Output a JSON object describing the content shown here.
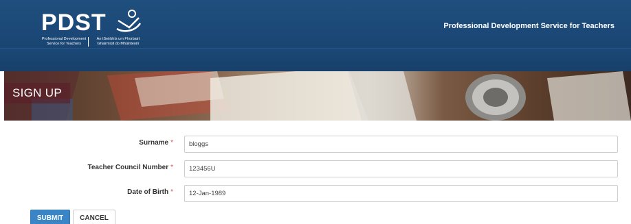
{
  "header": {
    "logo": {
      "wordmark": "PDST",
      "sub_left": "Professional Development Service for Teachers",
      "sub_right": "An tSeirbhís um Fhorbairt Ghairmiúil do Mhúinteoirí"
    },
    "tagline": "Professional Development Service for Teachers"
  },
  "banner": {
    "title": "SIGN UP"
  },
  "form": {
    "required_marker": "*",
    "fields": [
      {
        "label": "Surname",
        "value": "bloggs"
      },
      {
        "label": "Teacher Council Number",
        "value": "123456U"
      },
      {
        "label": "Date of Birth",
        "value": "12-Jan-1989"
      }
    ],
    "submit_label": "SUBMIT",
    "cancel_label": "CANCEL"
  },
  "colors": {
    "header_bg": "#1a4674",
    "submit_bg": "#3a85c6",
    "required": "#d9534f"
  }
}
